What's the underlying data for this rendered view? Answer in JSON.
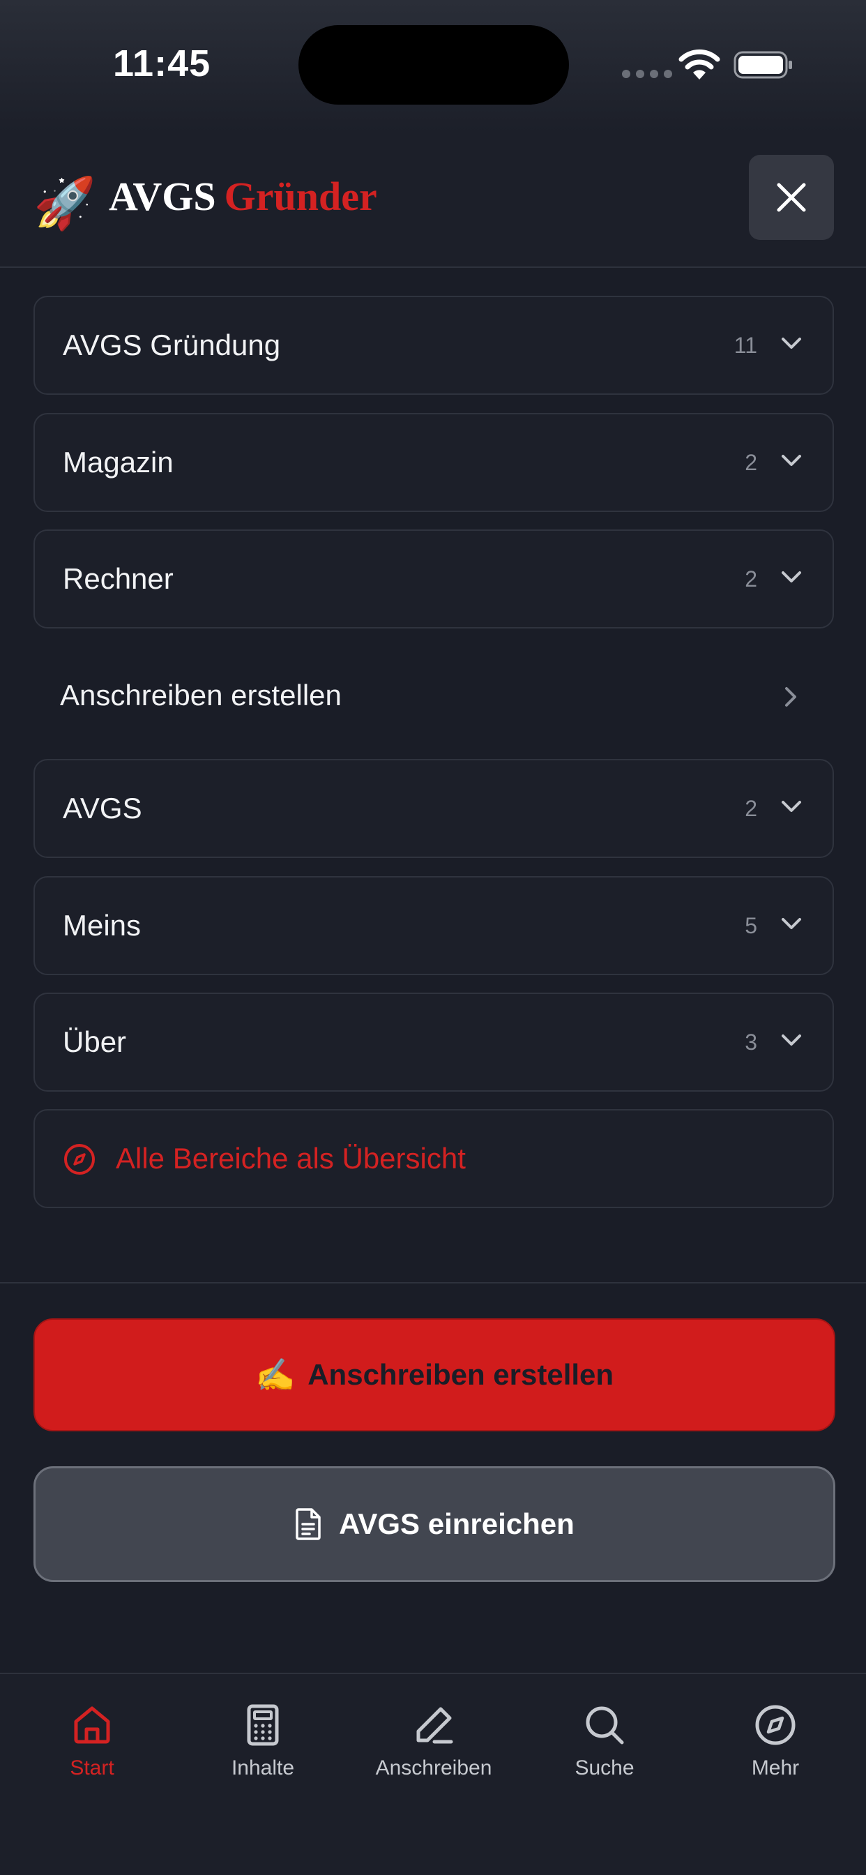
{
  "status": {
    "time": "11:45"
  },
  "header": {
    "brand_part1": "AVGS",
    "brand_part2": "Gründer",
    "logo_icon": "rocket-icon",
    "close_icon": "close-icon"
  },
  "menu": {
    "items": [
      {
        "label": "AVGS Gründung",
        "count": "11"
      },
      {
        "label": "Magazin",
        "count": "2"
      },
      {
        "label": "Rechner",
        "count": "2"
      },
      {
        "label": "Anschreiben erstellen"
      },
      {
        "label": "AVGS",
        "count": "2"
      },
      {
        "label": "Meins",
        "count": "5"
      },
      {
        "label": "Über",
        "count": "3"
      }
    ],
    "overview_label": "Alle Bereiche als Übersicht"
  },
  "actions": {
    "primary_emoji": "✍️",
    "primary_label": "Anschreiben erstellen",
    "secondary_label": "AVGS einreichen"
  },
  "tabs": [
    {
      "label": "Start",
      "icon": "home-icon",
      "active": true
    },
    {
      "label": "Inhalte",
      "icon": "calculator-icon",
      "active": false
    },
    {
      "label": "Anschreiben",
      "icon": "pen-icon",
      "active": false
    },
    {
      "label": "Suche",
      "icon": "search-icon",
      "active": false
    },
    {
      "label": "Mehr",
      "icon": "compass-icon",
      "active": false
    }
  ],
  "colors": {
    "background": "#1a1d27",
    "accent_red": "#d42222",
    "button_red": "#d11c1c",
    "secondary_button": "#424650",
    "muted_text": "#8a8e98"
  }
}
